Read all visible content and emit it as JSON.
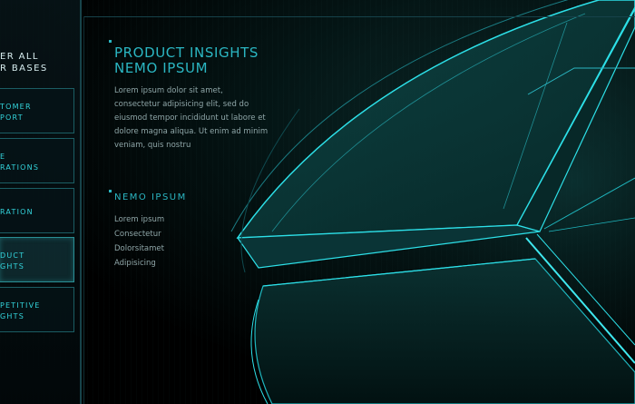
{
  "sidebar": {
    "heading": "ER ALL\nR BASES",
    "items": [
      {
        "label": "TOMER\nPORT",
        "active": false
      },
      {
        "label": "E\nRATIONS",
        "active": false
      },
      {
        "label": "RATION",
        "active": false
      },
      {
        "label": "DUCT\nGHTS",
        "active": true
      },
      {
        "label": "PETITIVE\nGHTS",
        "active": false
      }
    ]
  },
  "main": {
    "title": "PRODUCT INSIGHTS\nNEMO IPSUM",
    "body": "Lorem ipsum dolor sit amet, consectetur adipisicing elit, sed do eiusmod tempor incididunt ut labore et dolore magna aliqua. Ut enim ad minim veniam, quis nostru",
    "subheading": "NEMO IPSUM",
    "list": [
      "Lorem ipsum",
      "Consectetur",
      "Dolorsitamet",
      "Adipisicing"
    ]
  },
  "colors": {
    "accent": "#2bb6c2",
    "glow": "#3fe9f0",
    "text": "#8fa6a8",
    "background": "#000000"
  }
}
